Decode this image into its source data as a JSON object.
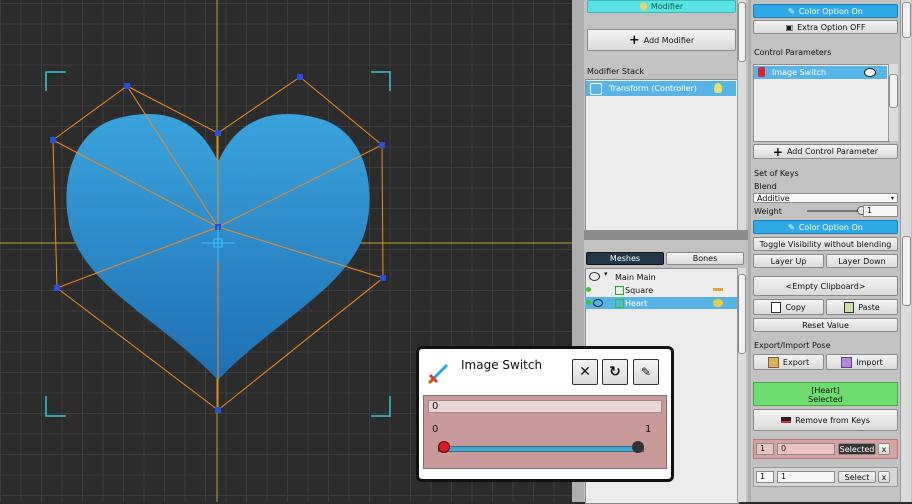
{
  "viewport": {},
  "middle": {
    "modifier_tab": "Modifier",
    "add_modifier": "Add Modifier",
    "modifier_stack_label": "Modifier Stack",
    "stack_item": "Transform (Controller)",
    "tabs": {
      "meshes": "Meshes",
      "bones": "Bones"
    },
    "tree": {
      "main": "Main Main",
      "square": "Square",
      "heart": "Heart"
    }
  },
  "right": {
    "color_option_on": "Color Option On",
    "extra_option": "Extra Option OFF",
    "control_params_label": "Control Parameters",
    "param_item": "Image Switch",
    "add_control_param": "Add Control Parameter",
    "set_of_keys": "Set of Keys",
    "blend_label": "Blend",
    "blend_value": "Additive",
    "weight_label": "Weight",
    "weight_value": "1",
    "weight_level": 1.0,
    "color_option_on_2": "Color Option On",
    "toggle_visibility": "Toggle Visibility without blending",
    "layer_up": "Layer Up",
    "layer_down": "Layer Down",
    "clipboard": "<Empty Clipboard>",
    "copy": "Copy",
    "paste": "Paste",
    "reset_value": "Reset Value",
    "export_import_label": "Export/Import Pose",
    "export": "Export",
    "import": "Import",
    "selected_line1": "[Heart]",
    "selected_line2": "Selected",
    "remove_from_keys": "Remove from Keys",
    "key1_index": "1",
    "key1_value": "0",
    "key1_btn": "Selected",
    "key1_x": "x",
    "key2_index": "1",
    "key2_value": "1",
    "key2_btn": "Select",
    "key2_x": "x"
  },
  "popup": {
    "title": "Image Switch",
    "value_field": "0",
    "min": "0",
    "max": "1",
    "slider_level": 0.0
  },
  "colors": {
    "heart_top": "#3aa3dc",
    "heart_bottom": "#1f6fb2",
    "outline": "#f08a1f",
    "selection_green": "#6fdc6f",
    "popup_bg": "#c99a9a"
  }
}
